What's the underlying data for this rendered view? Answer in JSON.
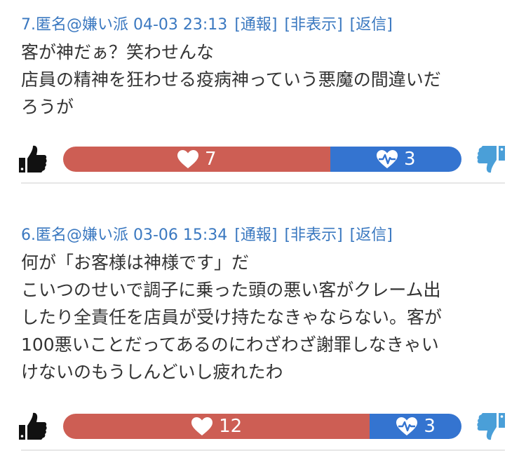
{
  "comments": [
    {
      "header": "7.匿名@嫌い派 04-03 23:13",
      "report": "[通報]",
      "hide": "[非表示]",
      "reply": "[返信]",
      "lines": [
        "客が神だぁ？笑わせんな",
        "店員の精神を狂わせる疫病神っていう悪魔の間違いだ",
        "ろうが"
      ],
      "good_count": "7",
      "bad_count": "3",
      "good_share": 0.67
    },
    {
      "header": "6.匿名@嫌い派 03-06 15:34",
      "report": "[通報]",
      "hide": "[非表示]",
      "reply": "[返信]",
      "lines": [
        "何が「お客様は神様です」だ",
        "こいつのせいで調子に乗った頭の悪い客がクレーム出",
        "したり全責任を店員が受け持たなきゃならない。客が",
        "100悪いことだってあるのにわざわざ謝罪しなきゃい",
        "けないのもうしんどいし疲れたわ"
      ],
      "good_count": "12",
      "bad_count": "3",
      "good_share": 0.77
    }
  ],
  "colors": {
    "link": "#3a78c0",
    "good_bar": "#cd5e54",
    "bad_bar": "#3474d0",
    "thumb_up": "#111111",
    "thumb_down": "#4a9fd8"
  },
  "icons": {
    "thumb_up": "thumbs-up-icon",
    "thumb_down": "thumbs-down-icon",
    "good": "heart-icon",
    "bad": "heart-pulse-icon"
  }
}
